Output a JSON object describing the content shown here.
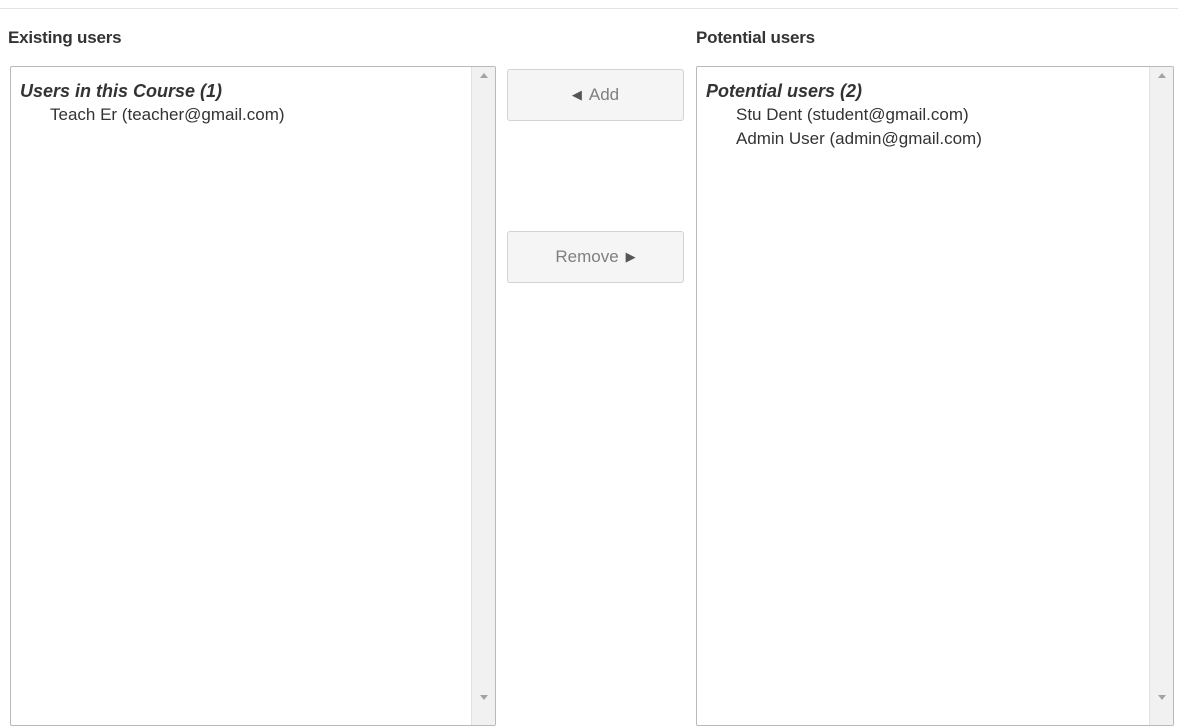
{
  "existing": {
    "heading": "Existing users",
    "group_label": "Users in this Course (1)",
    "options": [
      "Teach Er (teacher@gmail.com)"
    ]
  },
  "potential": {
    "heading": "Potential users",
    "group_label": "Potential users (2)",
    "options": [
      "Stu Dent (student@gmail.com)",
      "Admin User (admin@gmail.com)"
    ]
  },
  "actions": {
    "add_label": "Add",
    "add_icon": "◀",
    "remove_label": "Remove",
    "remove_icon": "▶"
  },
  "colors": {
    "text": "#333333",
    "button_text": "#7f7f7f",
    "button_bg": "#f5f5f5",
    "listbox_border": "#b9b9b9",
    "scrollbar_bg": "#f1f1f1"
  }
}
